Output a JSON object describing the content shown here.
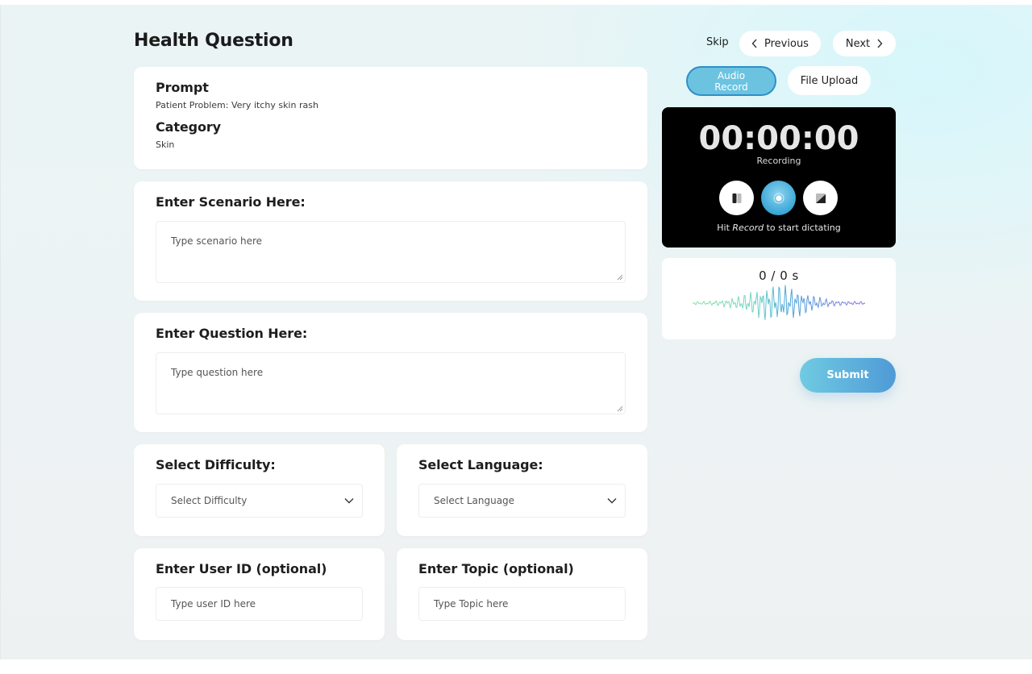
{
  "page": {
    "title": "Health Question"
  },
  "nav": {
    "skip": "Skip",
    "previous": "Previous",
    "next": "Next"
  },
  "prompt": {
    "heading": "Prompt",
    "text": "Patient Problem: Very itchy skin rash",
    "category_heading": "Category",
    "category_value": "Skin"
  },
  "scenario": {
    "heading": "Enter Scenario Here:",
    "placeholder": "Type scenario here"
  },
  "question": {
    "heading": "Enter Question Here:",
    "placeholder": "Type question here"
  },
  "difficulty": {
    "heading": "Select Difficulty:",
    "selected": "Select Difficulty"
  },
  "language": {
    "heading": "Select Language:",
    "selected": "Select Language"
  },
  "user_id": {
    "heading": "Enter User ID (optional)",
    "placeholder": "Type user ID here"
  },
  "topic": {
    "heading": "Enter Topic (optional)",
    "placeholder": "Type Topic here"
  },
  "tabs": {
    "audio_line1": "Audio",
    "audio_line2": "Record",
    "file_upload": "File Upload"
  },
  "recorder": {
    "timer": "00:00:00",
    "status": "Recording",
    "hint_prefix": "Hit",
    "hint_emphasis": "Record",
    "hint_suffix": "to start dictating"
  },
  "waveform": {
    "duration": "0 / 0 s"
  },
  "submit": "Submit",
  "colors": {
    "accent": "#6cc3e0",
    "accent_border": "#2f8fc7",
    "recorder_bg": "#000000",
    "submit_start": "#6fcbe2",
    "submit_end": "#4f9ad7"
  }
}
